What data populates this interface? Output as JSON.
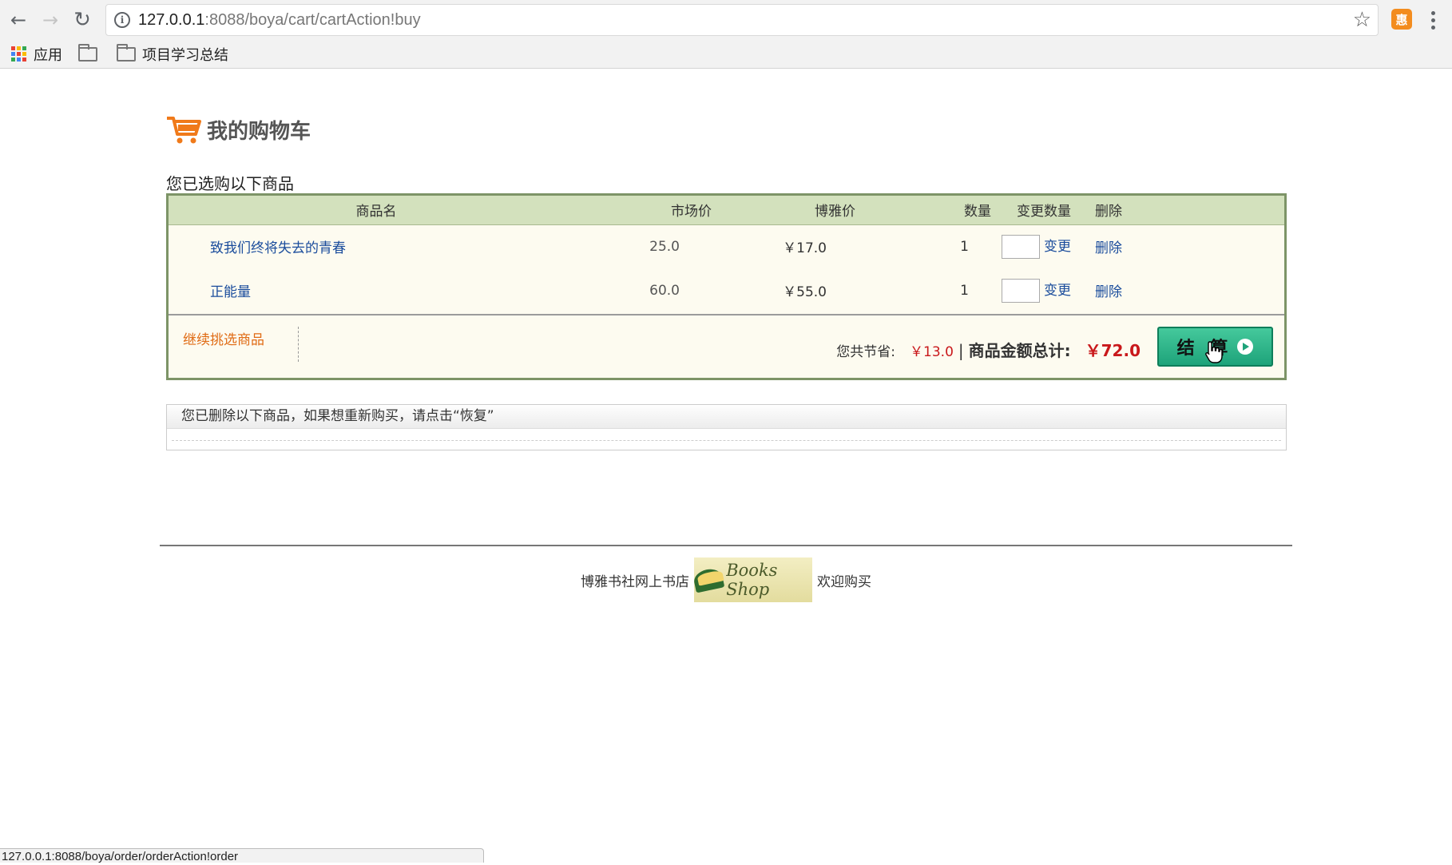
{
  "browser": {
    "url_host": "127.0.0.1",
    "url_path": ":8088/boya/cart/cartAction!buy",
    "bookmarks": [
      {
        "label": "应用",
        "icon": "apps-icon"
      },
      {
        "label": "",
        "icon": "folder-icon"
      },
      {
        "label": "项目学习总结",
        "icon": "folder-icon"
      }
    ],
    "extension_label": "惠",
    "status_url": "127.0.0.1:8088/boya/order/orderAction!order"
  },
  "cart": {
    "title": "我的购物车",
    "selected_caption": "您已选购以下商品",
    "columns": [
      "商品名",
      "市场价",
      "博雅价",
      "数量",
      "变更数量",
      "删除"
    ],
    "items": [
      {
        "name": "致我们终将失去的青春",
        "market_price": "25.0",
        "boya_price": "￥17.0",
        "quantity": "1",
        "change_label": "变更",
        "delete_label": "删除",
        "qty_value": ""
      },
      {
        "name": "正能量",
        "market_price": "60.0",
        "boya_price": "￥55.0",
        "quantity": "1",
        "change_label": "变更",
        "delete_label": "删除",
        "qty_value": ""
      }
    ],
    "continue_label": "继续挑选商品",
    "save_label": "您共节省:",
    "save_value": "￥13.0",
    "separator": "|",
    "total_label": "商品金额总计:",
    "total_value": "￥72.0",
    "checkout_label": "结 算"
  },
  "deleted": {
    "caption": "您已删除以下商品，如果想重新购买，请点击“恢复”"
  },
  "footer": {
    "left_text": "博雅书社网上书店",
    "logo_text": "Books Shop",
    "right_text": "欢迎购买"
  },
  "colors": {
    "accent_orange": "#e06b14",
    "price_red": "#c9181b",
    "link_blue": "#1a4c9c",
    "table_header_green": "#d3e1bd",
    "checkout_green": "#1ea37a"
  }
}
